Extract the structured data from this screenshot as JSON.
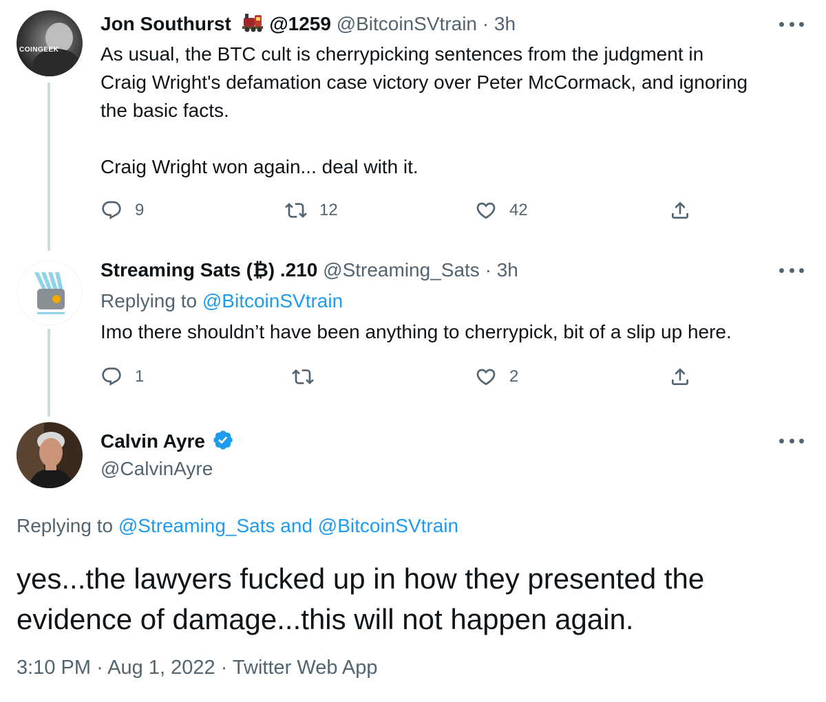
{
  "tweets": [
    {
      "name": "Jon Southurst",
      "name_suffix": "@1259",
      "handle": "@BitcoinSVtrain",
      "separator": "·",
      "time": "3h",
      "text_lines": [
        "As usual, the BTC cult is cherrypicking sentences from the judgment in",
        "Craig Wright's defamation case victory over Peter McCormack, and ignoring",
        "the basic facts."
      ],
      "text_line2": "Craig Wright won again... deal with it.",
      "avatar_text": "COINGEEK",
      "reply_count": "9",
      "retweet_count": "12",
      "like_count": "42"
    },
    {
      "name": "Streaming Sats (₿) .210",
      "handle": "@Streaming_Sats",
      "separator": "·",
      "time": "3h",
      "replying_prefix": "Replying to",
      "replying_to": "@BitcoinSVtrain",
      "text": "Imo there shouldn’t have been anything to cherrypick, bit of a slip up here.",
      "reply_count": "1",
      "retweet_count": "",
      "like_count": "2"
    }
  ],
  "main_tweet": {
    "name": "Calvin Ayre",
    "handle": "@CalvinAyre",
    "replying_prefix": "Replying to",
    "replying_to_1": "@Streaming_Sats",
    "and_word": "and",
    "replying_to_2": "@BitcoinSVtrain",
    "text": "yes...the lawyers fucked up in how they presented the evidence of damage...this will not happen again.",
    "time": "3:10 PM",
    "separator": "·",
    "date": "Aug 1, 2022",
    "source": "Twitter Web App"
  },
  "colors": {
    "accent": "#1d9bf0",
    "secondary_text": "#536471",
    "thread_line": "#cfd9de"
  },
  "icons": [
    "reply-icon",
    "retweet-icon",
    "like-icon",
    "share-icon",
    "more-icon",
    "train-emoji-icon",
    "verified-badge-icon"
  ]
}
